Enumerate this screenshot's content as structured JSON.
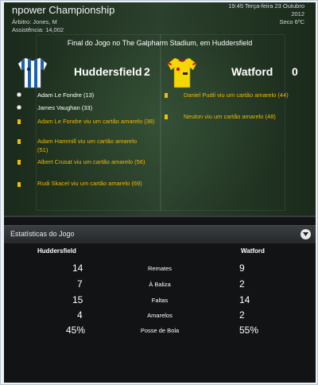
{
  "match": {
    "competition": "npower Championship",
    "referee": "Árbitro: Jones, M",
    "attendance": "Assistência: 14,002",
    "datetime": "19:45 Terça-feira 23 Outubro",
    "year": "2012",
    "weather": "Seco 6ºC",
    "venue": "Final do Jogo no The Galpharm Stadium, em Huddersfield"
  },
  "home": {
    "name": "Huddersfield",
    "score": "2",
    "shirt_colors": [
      "#1f5fb3",
      "#ffffff"
    ],
    "events": [
      {
        "type": "goal",
        "text": "Adam Le Fondre (13)"
      },
      {
        "type": "goal",
        "text": "James Vaughan (33)"
      },
      {
        "type": "card",
        "text": "Adam Le Fondre viu um cartão amarelo (38)"
      },
      {
        "type": "card",
        "text": "Adam Hammill viu um cartão amarelo (51)"
      },
      {
        "type": "card",
        "text": "Albert Crusat viu um cartão amarelo (56)"
      },
      {
        "type": "card",
        "text": "Rudi Skacel viu um cartão amarelo (69)"
      }
    ]
  },
  "away": {
    "name": "Watford",
    "score": "0",
    "shirt_colors": [
      "#f5d800",
      "#c8102e"
    ],
    "events": [
      {
        "type": "card",
        "text": "Daniel Pudil viu um cartão amarelo (44)"
      },
      {
        "type": "card",
        "text": "Neuton viu um cartão amarelo (48)"
      }
    ]
  },
  "stats": {
    "title": "Estatísticas do Jogo",
    "home_header": "Huddersfield",
    "away_header": "Watford",
    "rows": [
      {
        "label": "Remates",
        "home": "14",
        "away": "9"
      },
      {
        "label": "À Baliza",
        "home": "7",
        "away": "2"
      },
      {
        "label": "Faltas",
        "home": "15",
        "away": "14"
      },
      {
        "label": "Amarelos",
        "home": "4",
        "away": "2"
      },
      {
        "label": "Posse de Bola",
        "home": "45%",
        "away": "55%"
      }
    ]
  },
  "colors": {
    "card_yellow": "#f0c000",
    "event_yellow_text": "#f0b800"
  },
  "icons": {
    "goal": "football-icon",
    "card": "yellow-card-icon",
    "toggle": "chevron-down-icon"
  }
}
